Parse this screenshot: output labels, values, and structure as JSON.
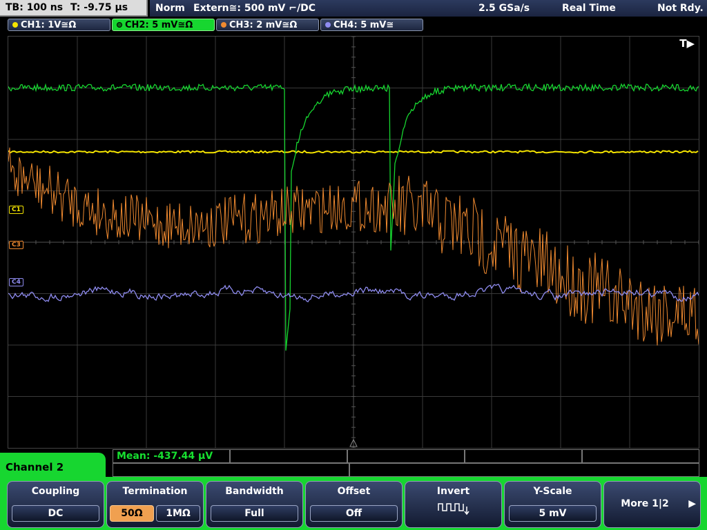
{
  "top": {
    "timebase": "TB: 100 ns",
    "trigger_time": "T: -9.75 µs",
    "trigger_mode": "Norm",
    "trigger_source": "Extern≅: 500 mV ⌐/DC",
    "sample_rate": "2.5 GSa/s",
    "acq_mode": "Real Time",
    "status": "Not Rdy."
  },
  "channels": [
    {
      "label": "CH1: 1V≅Ω",
      "color": "#f5e500"
    },
    {
      "label": "CH2: 5 mV≅Ω",
      "color": "#17d630",
      "active": true
    },
    {
      "label": "CH3: 2 mV≅Ω",
      "color": "#f08a30"
    },
    {
      "label": "CH4: 5 mV≅",
      "color": "#8f8cf0"
    }
  ],
  "screen": {
    "trigger_marker": "T▶",
    "markers": [
      "C1",
      "C3",
      "C4"
    ]
  },
  "measurement": {
    "label": "Mean: -437.44 µV"
  },
  "menu": {
    "title": "Channel 2",
    "coupling": {
      "title": "Coupling",
      "value": "DC"
    },
    "termination": {
      "title": "Termination",
      "options": [
        "50Ω",
        "1MΩ"
      ],
      "selected": "50Ω"
    },
    "bandwidth": {
      "title": "Bandwidth",
      "value": "Full"
    },
    "offset": {
      "title": "Offset",
      "value": "Off"
    },
    "invert": {
      "title": "Invert"
    },
    "yscale": {
      "title": "Y-Scale",
      "value": "5 mV"
    },
    "more": {
      "label": "More 1|2"
    }
  }
}
